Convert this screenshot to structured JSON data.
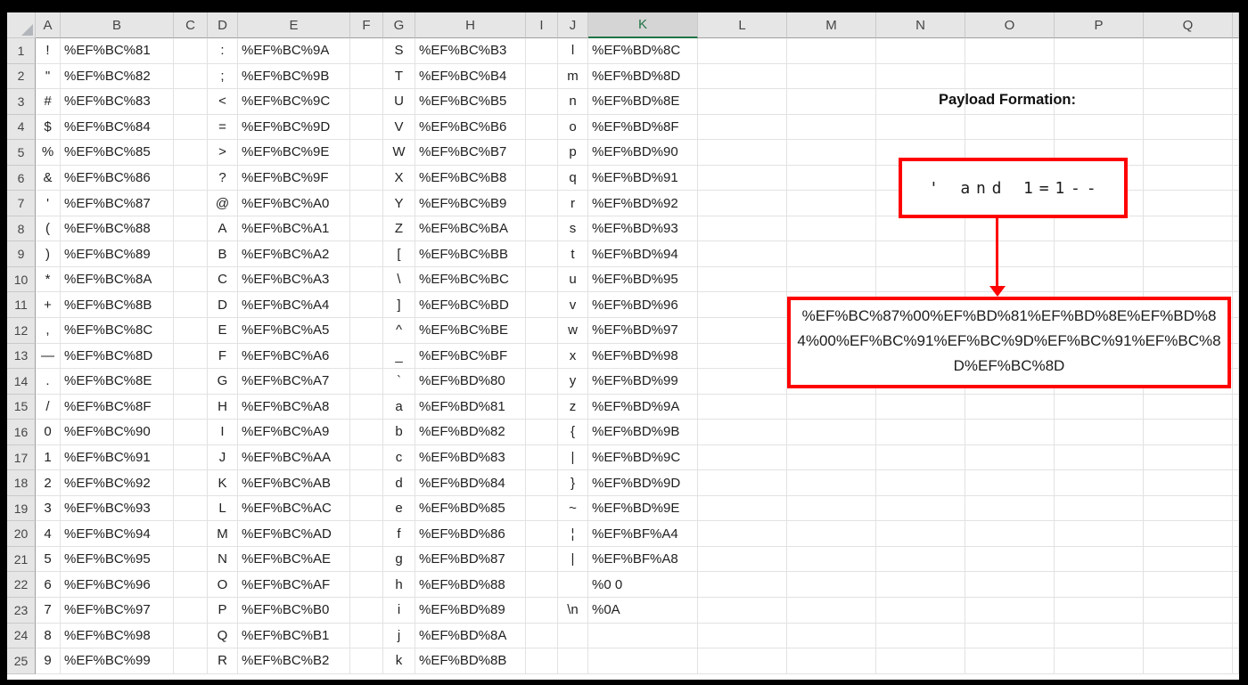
{
  "sheet": {
    "columns": [
      "A",
      "B",
      "C",
      "D",
      "E",
      "F",
      "G",
      "H",
      "I",
      "J",
      "K",
      "L",
      "M",
      "N",
      "O",
      "P",
      "Q"
    ],
    "selected_column": "K",
    "rows": [
      {
        "n": "1",
        "a": "!",
        "b": "%EF%BC%81",
        "d": ":",
        "e": "%EF%BC%9A",
        "g": "S",
        "h": "%EF%BC%B3",
        "j": "l",
        "k": "%EF%BD%8C"
      },
      {
        "n": "2",
        "a": "\"",
        "b": "%EF%BC%82",
        "d": ";",
        "e": "%EF%BC%9B",
        "g": "T",
        "h": "%EF%BC%B4",
        "j": "m",
        "k": "%EF%BD%8D"
      },
      {
        "n": "3",
        "a": "#",
        "b": "%EF%BC%83",
        "d": "<",
        "e": "%EF%BC%9C",
        "g": "U",
        "h": "%EF%BC%B5",
        "j": "n",
        "k": "%EF%BD%8E"
      },
      {
        "n": "4",
        "a": "$",
        "b": "%EF%BC%84",
        "d": "=",
        "e": "%EF%BC%9D",
        "g": "V",
        "h": "%EF%BC%B6",
        "j": "o",
        "k": "%EF%BD%8F"
      },
      {
        "n": "5",
        "a": "%",
        "b": "%EF%BC%85",
        "d": ">",
        "e": "%EF%BC%9E",
        "g": "W",
        "h": "%EF%BC%B7",
        "j": "p",
        "k": "%EF%BD%90"
      },
      {
        "n": "6",
        "a": "&",
        "b": "%EF%BC%86",
        "d": "?",
        "e": "%EF%BC%9F",
        "g": "X",
        "h": "%EF%BC%B8",
        "j": "q",
        "k": "%EF%BD%91"
      },
      {
        "n": "7",
        "a": "'",
        "b": "%EF%BC%87",
        "d": "@",
        "e": "%EF%BC%A0",
        "g": "Y",
        "h": "%EF%BC%B9",
        "j": "r",
        "k": "%EF%BD%92"
      },
      {
        "n": "8",
        "a": "(",
        "b": "%EF%BC%88",
        "d": "A",
        "e": "%EF%BC%A1",
        "g": "Z",
        "h": "%EF%BC%BA",
        "j": "s",
        "k": "%EF%BD%93"
      },
      {
        "n": "9",
        "a": ")",
        "b": "%EF%BC%89",
        "d": "B",
        "e": "%EF%BC%A2",
        "g": "[",
        "h": "%EF%BC%BB",
        "j": "t",
        "k": "%EF%BD%94"
      },
      {
        "n": "10",
        "a": "*",
        "b": "%EF%BC%8A",
        "d": "C",
        "e": "%EF%BC%A3",
        "g": "\\",
        "h": "%EF%BC%BC",
        "j": "u",
        "k": "%EF%BD%95"
      },
      {
        "n": "11",
        "a": "+",
        "b": "%EF%BC%8B",
        "d": "D",
        "e": "%EF%BC%A4",
        "g": "]",
        "h": "%EF%BC%BD",
        "j": "v",
        "k": "%EF%BD%96"
      },
      {
        "n": "12",
        "a": ",",
        "b": "%EF%BC%8C",
        "d": "E",
        "e": "%EF%BC%A5",
        "g": "^",
        "h": "%EF%BC%BE",
        "j": "w",
        "k": "%EF%BD%97"
      },
      {
        "n": "13",
        "a": "—",
        "b": "%EF%BC%8D",
        "d": "F",
        "e": "%EF%BC%A6",
        "g": "_",
        "h": "%EF%BC%BF",
        "j": "x",
        "k": "%EF%BD%98"
      },
      {
        "n": "14",
        "a": ".",
        "b": "%EF%BC%8E",
        "d": "G",
        "e": "%EF%BC%A7",
        "g": "`",
        "h": "%EF%BD%80",
        "j": "y",
        "k": "%EF%BD%99"
      },
      {
        "n": "15",
        "a": "/",
        "b": "%EF%BC%8F",
        "d": "H",
        "e": "%EF%BC%A8",
        "g": "a",
        "h": "%EF%BD%81",
        "j": "z",
        "k": "%EF%BD%9A"
      },
      {
        "n": "16",
        "a": "0",
        "b": "%EF%BC%90",
        "d": "I",
        "e": "%EF%BC%A9",
        "g": "b",
        "h": "%EF%BD%82",
        "j": "{",
        "k": "%EF%BD%9B"
      },
      {
        "n": "17",
        "a": "1",
        "b": "%EF%BC%91",
        "d": "J",
        "e": "%EF%BC%AA",
        "g": "c",
        "h": "%EF%BD%83",
        "j": "|",
        "k": "%EF%BD%9C"
      },
      {
        "n": "18",
        "a": "2",
        "b": "%EF%BC%92",
        "d": "K",
        "e": "%EF%BC%AB",
        "g": "d",
        "h": "%EF%BD%84",
        "j": "}",
        "k": "%EF%BD%9D"
      },
      {
        "n": "19",
        "a": "3",
        "b": "%EF%BC%93",
        "d": "L",
        "e": "%EF%BC%AC",
        "g": "e",
        "h": "%EF%BD%85",
        "j": "~",
        "k": "%EF%BD%9E"
      },
      {
        "n": "20",
        "a": "4",
        "b": "%EF%BC%94",
        "d": "M",
        "e": "%EF%BC%AD",
        "g": "f",
        "h": "%EF%BD%86",
        "j": "¦",
        "k": "%EF%BF%A4"
      },
      {
        "n": "21",
        "a": "5",
        "b": "%EF%BC%95",
        "d": "N",
        "e": "%EF%BC%AE",
        "g": "g",
        "h": "%EF%BD%87",
        "j": "|",
        "k": "%EF%BF%A8"
      },
      {
        "n": "22",
        "a": "6",
        "b": "%EF%BC%96",
        "d": "O",
        "e": "%EF%BC%AF",
        "g": "h",
        "h": "%EF%BD%88",
        "j": "",
        "k": "%0 0"
      },
      {
        "n": "23",
        "a": "7",
        "b": "%EF%BC%97",
        "d": "P",
        "e": "%EF%BC%B0",
        "g": "i",
        "h": "%EF%BD%89",
        "j": "\\n",
        "k": "%0A"
      },
      {
        "n": "24",
        "a": "8",
        "b": "%EF%BC%98",
        "d": "Q",
        "e": "%EF%BC%B1",
        "g": "j",
        "h": "%EF%BD%8A",
        "j": "",
        "k": ""
      },
      {
        "n": "25",
        "a": "9",
        "b": "%EF%BC%99",
        "d": "R",
        "e": "%EF%BC%B2",
        "g": "k",
        "h": "%EF%BD%8B",
        "j": "",
        "k": ""
      }
    ]
  },
  "annotation": {
    "title": "Payload Formation:",
    "payload_plain": "' and 1=1--",
    "payload_encoded": "%EF%BC%87%00%EF%BD%81%EF%BD%8E%EF%BD%84%00%EF%BC%91%EF%BC%9D%EF%BC%91%EF%BC%8D%EF%BC%8D"
  },
  "colors": {
    "highlight_red": "#FF0000",
    "excel_green": "#217346",
    "header_gray": "#E6E6E6",
    "selected_header_gray": "#D5D5D5"
  }
}
